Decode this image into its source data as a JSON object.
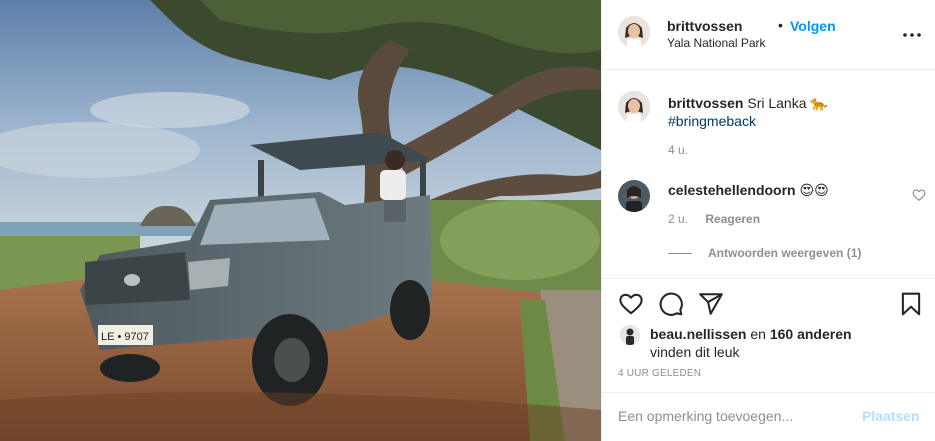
{
  "header": {
    "username": "brittvossen",
    "separator": "•",
    "follow_label": "Volgen",
    "location": "Yala National Park"
  },
  "caption": {
    "username": "brittvossen",
    "text": "Sri Lanka 🐆",
    "hashtag": "#bringmeback",
    "age": "4 u."
  },
  "comments": [
    {
      "username": "celestehellendoorn",
      "text": "😍😍",
      "age": "2 u.",
      "reply_label": "Reageren",
      "view_replies_label": "Antwoorden weergeven (1)"
    }
  ],
  "likes": {
    "liker": "beau.nellissen",
    "connector": "en",
    "others": "160 anderen",
    "suffix": "vinden dit leuk"
  },
  "timestamp": "4 UUR GELEDEN",
  "add_comment": {
    "placeholder": "Een opmerking toevoegen...",
    "post_label": "Plaatsen"
  },
  "icons": {
    "more": "more-options-icon",
    "heart": "heart-icon",
    "comment": "comment-icon",
    "share": "share-icon",
    "save": "bookmark-icon"
  },
  "colors": {
    "link_blue": "#0095f6",
    "hashtag": "#00376b",
    "muted": "#8e8e8e",
    "post_disabled": "#b2dffc"
  }
}
